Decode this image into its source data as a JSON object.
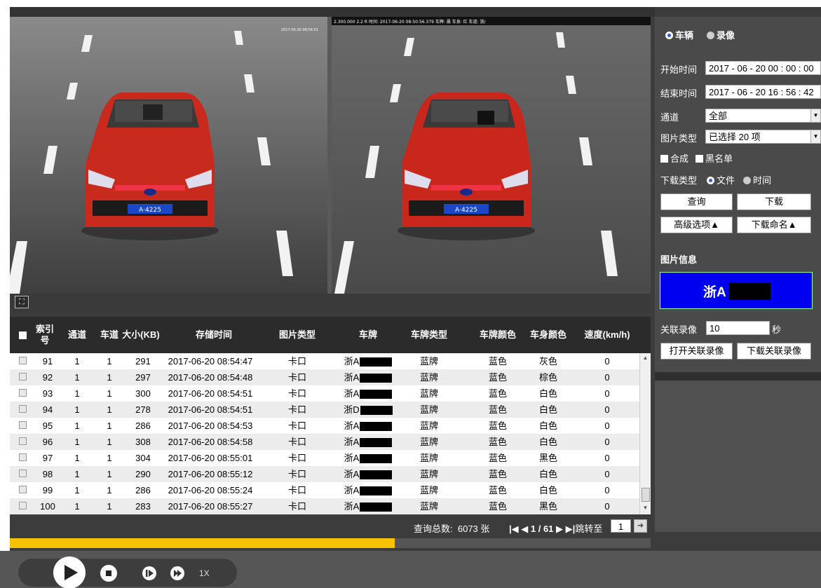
{
  "camera": {
    "overlay_left": "2017-06-20 08:54:51",
    "overlay_right": "2.300.000 2.2 R 时间: 2017-06-20 08:50:56.379 车牌: 晨 车身: 红 车道: 浙/",
    "plate_left": "A·4225",
    "plate_right": "A·4225",
    "fullscreen_icon": "fullscreen-icon"
  },
  "table": {
    "headers": {
      "select_all": "",
      "index": "索引号",
      "channel": "通道",
      "lane": "车道",
      "size": "大小(KB)",
      "time": "存储时间",
      "pic_type": "图片类型",
      "plate": "车牌",
      "plate_type": "车牌类型",
      "plate_color": "车牌颜色",
      "body_color": "车身颜色",
      "speed": "速度(km/h)"
    },
    "rows": [
      {
        "index": "91",
        "channel": "1",
        "lane": "1",
        "size": "291",
        "time": "2017-06-20 08:54:47",
        "pic_type": "卡口",
        "plate": "浙A",
        "plate_type": "蓝牌",
        "plate_color": "蓝色",
        "body_color": "灰色",
        "speed": "0"
      },
      {
        "index": "92",
        "channel": "1",
        "lane": "1",
        "size": "297",
        "time": "2017-06-20 08:54:48",
        "pic_type": "卡口",
        "plate": "浙A",
        "plate_type": "蓝牌",
        "plate_color": "蓝色",
        "body_color": "棕色",
        "speed": "0"
      },
      {
        "index": "93",
        "channel": "1",
        "lane": "1",
        "size": "300",
        "time": "2017-06-20 08:54:51",
        "pic_type": "卡口",
        "plate": "浙A",
        "plate_type": "蓝牌",
        "plate_color": "蓝色",
        "body_color": "白色",
        "speed": "0"
      },
      {
        "index": "94",
        "channel": "1",
        "lane": "1",
        "size": "278",
        "time": "2017-06-20 08:54:51",
        "pic_type": "卡口",
        "plate": "浙D",
        "plate_type": "蓝牌",
        "plate_color": "蓝色",
        "body_color": "白色",
        "speed": "0"
      },
      {
        "index": "95",
        "channel": "1",
        "lane": "1",
        "size": "286",
        "time": "2017-06-20 08:54:53",
        "pic_type": "卡口",
        "plate": "浙A",
        "plate_type": "蓝牌",
        "plate_color": "蓝色",
        "body_color": "白色",
        "speed": "0"
      },
      {
        "index": "96",
        "channel": "1",
        "lane": "1",
        "size": "308",
        "time": "2017-06-20 08:54:58",
        "pic_type": "卡口",
        "plate": "浙A",
        "plate_type": "蓝牌",
        "plate_color": "蓝色",
        "body_color": "白色",
        "speed": "0"
      },
      {
        "index": "97",
        "channel": "1",
        "lane": "1",
        "size": "304",
        "time": "2017-06-20 08:55:01",
        "pic_type": "卡口",
        "plate": "浙A",
        "plate_type": "蓝牌",
        "plate_color": "蓝色",
        "body_color": "黑色",
        "speed": "0"
      },
      {
        "index": "98",
        "channel": "1",
        "lane": "1",
        "size": "290",
        "time": "2017-06-20 08:55:12",
        "pic_type": "卡口",
        "plate": "浙A",
        "plate_type": "蓝牌",
        "plate_color": "蓝色",
        "body_color": "白色",
        "speed": "0"
      },
      {
        "index": "99",
        "channel": "1",
        "lane": "1",
        "size": "286",
        "time": "2017-06-20 08:55:24",
        "pic_type": "卡口",
        "plate": "浙A",
        "plate_type": "蓝牌",
        "plate_color": "蓝色",
        "body_color": "白色",
        "speed": "0"
      },
      {
        "index": "100",
        "channel": "1",
        "lane": "1",
        "size": "283",
        "time": "2017-06-20 08:55:27",
        "pic_type": "卡口",
        "plate": "浙A",
        "plate_type": "蓝牌",
        "plate_color": "蓝色",
        "body_color": "黑色",
        "speed": "0"
      }
    ]
  },
  "pager": {
    "total_label": "查询总数:",
    "total_value": "6073 张",
    "page_text": "1 / 61",
    "jump_label": "跳转至",
    "jump_value": "1",
    "first_icon": "first-page-icon",
    "prev_icon": "prev-page-icon",
    "next_icon": "next-page-icon",
    "last_icon": "last-page-icon"
  },
  "progress": {
    "fraction": 0.601,
    "color": "#f7c300"
  },
  "player": {
    "speed": "1X"
  },
  "panel": {
    "mode_vehicle": "车辆",
    "mode_record": "录像",
    "start_label": "开始时间",
    "start_value": "2017 - 06 - 20  00 : 00 : 00",
    "end_label": "结束时间",
    "end_value": "2017 - 06 - 20  16 : 56 : 42",
    "channel_label": "通道",
    "channel_value": "全部",
    "pic_type_label": "图片类型",
    "pic_type_value": "已选择 20 项",
    "composite_label": "合成",
    "blacklist_label": "黑名单",
    "download_type_label": "下载类型",
    "download_file": "文件",
    "download_time": "时间",
    "query_btn": "查询",
    "download_btn": "下载",
    "advanced_btn": "高级选项▲",
    "naming_btn": "下载命名▲",
    "pic_info_title": "图片信息",
    "plate_display": "浙A",
    "plate_bg": "#0000f0",
    "related_label": "关联录像",
    "related_value": "10",
    "related_unit": "秒",
    "open_related_btn": "打开关联录像",
    "download_related_btn": "下载关联录像"
  }
}
